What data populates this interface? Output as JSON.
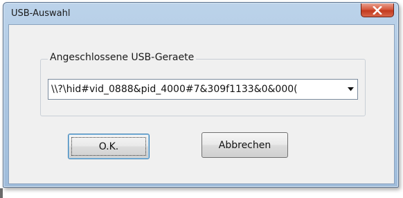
{
  "window": {
    "title": "USB-Auswahl",
    "close_icon": "close-x-icon"
  },
  "group": {
    "legend": "Angeschlossene USB-Geraete"
  },
  "device_select": {
    "selected_value": "\\\\?\\hid#vid_0888&pid_4000#7&309f1133&0&000(",
    "arrow_icon": "chevron-down-icon"
  },
  "buttons": {
    "ok_label": "O.K.",
    "cancel_label": "Abbrechen"
  },
  "colors": {
    "titlebar": "#a9c4e0",
    "close_button": "#c23a1e",
    "dialog_background": "#f0f0f0",
    "default_button_border": "#3c7fb1"
  }
}
